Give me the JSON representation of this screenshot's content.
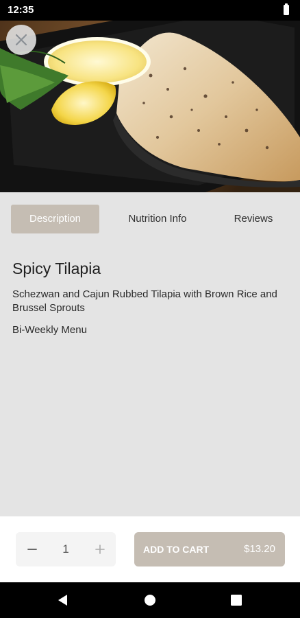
{
  "status_bar": {
    "time": "12:35"
  },
  "tabs": [
    {
      "label": "Description",
      "active": true
    },
    {
      "label": "Nutrition Info",
      "active": false
    },
    {
      "label": "Reviews",
      "active": false
    }
  ],
  "product": {
    "title": "Spicy Tilapia",
    "description": "Schezwan and Cajun Rubbed Tilapia with Brown Rice and Brussel Sprouts",
    "menu": "Bi-Weekly Menu"
  },
  "quantity": {
    "value": "1",
    "decrement_icon": "minus-icon",
    "increment_icon": "plus-icon"
  },
  "cart": {
    "label": "ADD TO CART",
    "price": "$13.20"
  },
  "colors": {
    "accent": "#c5bdb3",
    "background": "#e4e4e4",
    "surface": "#ffffff"
  },
  "icons": [
    "close-icon",
    "minus-icon",
    "plus-icon",
    "back-icon",
    "home-icon",
    "recents-icon",
    "battery-icon"
  ]
}
